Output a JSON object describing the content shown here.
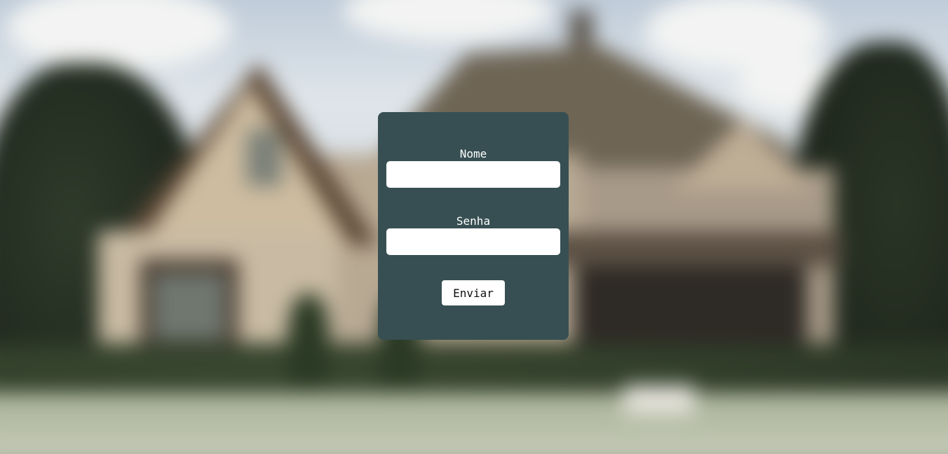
{
  "form": {
    "name_label": "Nome",
    "name_value": "",
    "name_placeholder": "",
    "password_label": "Senha",
    "password_value": "",
    "password_placeholder": "",
    "submit_label": "Enviar"
  },
  "colors": {
    "card_background": "#374f52",
    "input_background": "#ffffff",
    "label_text": "#ffffff",
    "button_background": "#ffffff"
  }
}
